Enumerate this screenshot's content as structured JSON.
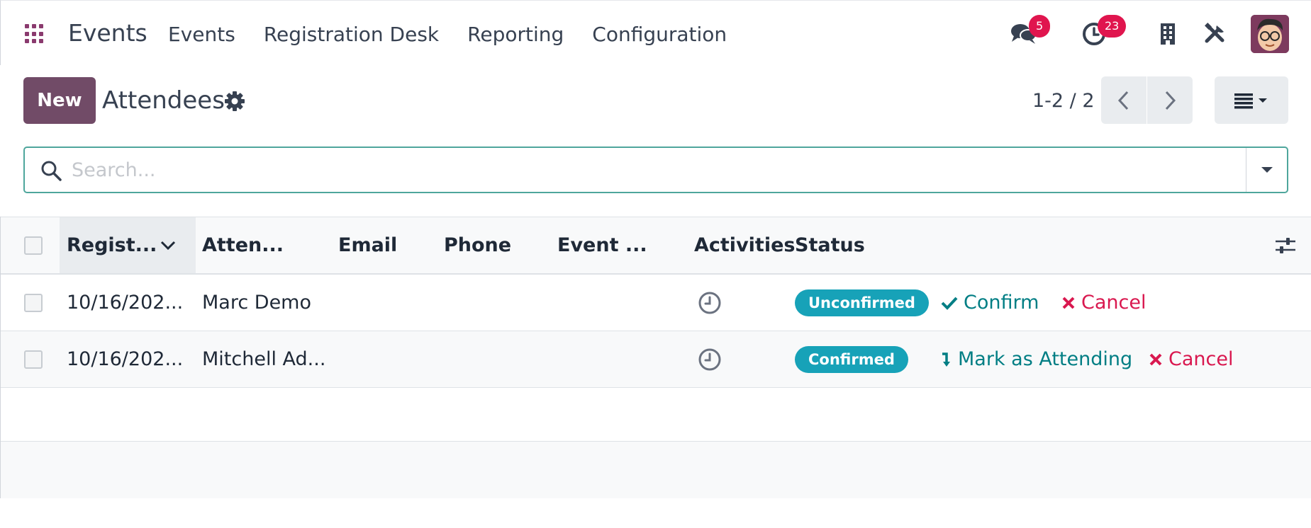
{
  "navbar": {
    "brand": "Events",
    "menu": [
      "Events",
      "Registration Desk",
      "Reporting",
      "Configuration"
    ],
    "messages_count": "5",
    "activities_count": "23"
  },
  "control_panel": {
    "new_label": "New",
    "title": "Attendees",
    "pager": "1-2 / 2"
  },
  "search": {
    "placeholder": "Search..."
  },
  "table": {
    "headers": [
      "Regist...",
      "Atten...",
      "Email",
      "Phone",
      "Event ...",
      "Activities",
      "Status"
    ],
    "rows": [
      {
        "registration": "10/16/202...",
        "attendee": "Marc Demo",
        "email": "",
        "phone": "",
        "event": "",
        "status": "Unconfirmed",
        "action_primary": "Confirm",
        "action_cancel": "Cancel"
      },
      {
        "registration": "10/16/202...",
        "attendee": "Mitchell Ad...",
        "email": "",
        "phone": "",
        "event": "",
        "status": "Confirmed",
        "action_primary": "Mark as Attending",
        "action_cancel": "Cancel"
      }
    ]
  },
  "colors": {
    "brand": "#714b67",
    "accent": "#017e84",
    "danger": "#d9184f",
    "status_pill": "#17a2b8",
    "badge": "#e0154e"
  },
  "icons": {
    "apps": "apps-grid-icon",
    "messages": "chat-icon",
    "activities": "clock-icon",
    "company": "building-icon",
    "settings": "tools-icon",
    "search": "search-icon",
    "gear": "gear-icon",
    "view": "list-view-icon",
    "optional_columns": "sliders-icon"
  }
}
